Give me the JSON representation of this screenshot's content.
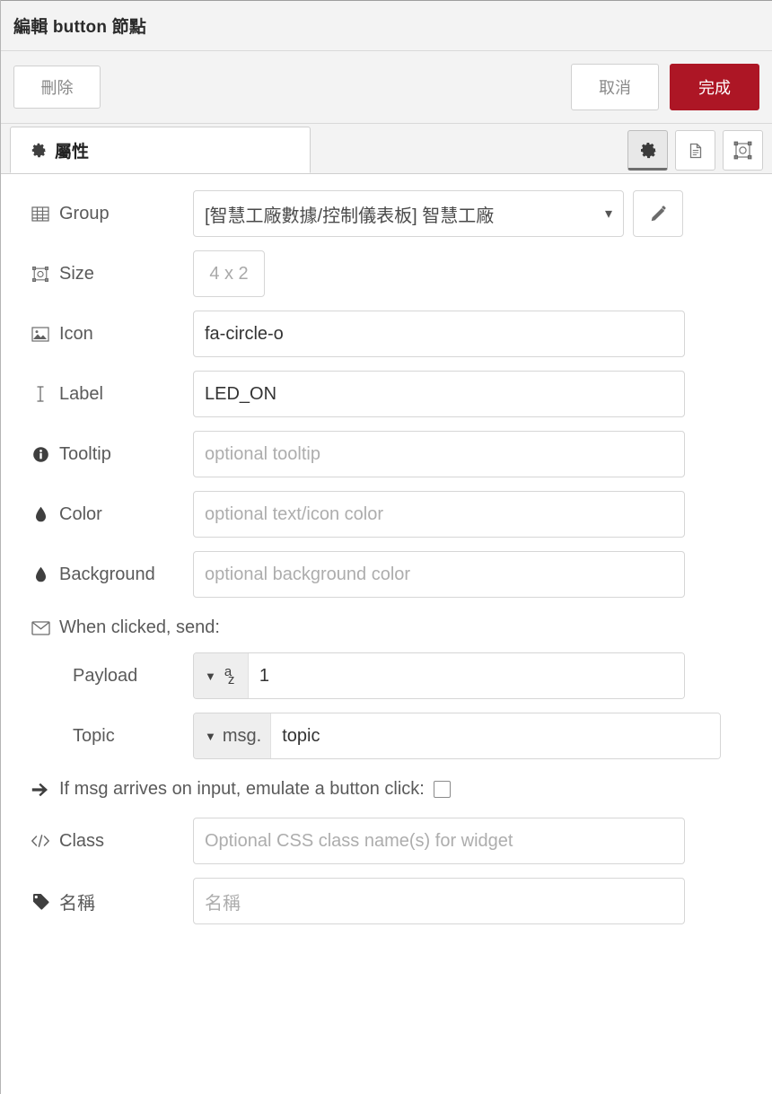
{
  "header": {
    "title_prefix": "編輯",
    "title_node": "button",
    "title_suffix": "節點",
    "title_full": "編輯 button 節點"
  },
  "toolbar": {
    "delete_label": "刪除",
    "cancel_label": "取消",
    "done_label": "完成",
    "done_color": "#ad1625"
  },
  "tabs": {
    "properties_label": "屬性",
    "properties_icon": "gear-icon",
    "tools": [
      {
        "name": "gear-icon",
        "active": true
      },
      {
        "name": "description-icon",
        "active": false
      },
      {
        "name": "appearance-icon",
        "active": false
      }
    ]
  },
  "form": {
    "group": {
      "label": "Group",
      "icon": "table-icon",
      "value": "[智慧工廠數據/控制儀表板] 智慧工廠",
      "caret": "chevron-down-icon",
      "edit_icon": "pencil-icon"
    },
    "size": {
      "label": "Size",
      "icon": "object-group-icon",
      "value": "4 x 2"
    },
    "icon_field": {
      "label": "Icon",
      "icon": "picture-icon",
      "value": "fa-circle-o"
    },
    "label_field": {
      "label": "Label",
      "icon": "text-cursor-icon",
      "value": "LED_ON"
    },
    "tooltip": {
      "label": "Tooltip",
      "icon": "info-circle-icon",
      "value": "",
      "placeholder": "optional tooltip"
    },
    "color": {
      "label": "Color",
      "icon": "tint-icon",
      "value": "",
      "placeholder": "optional text/icon color"
    },
    "background": {
      "label": "Background",
      "icon": "tint-icon",
      "value": "",
      "placeholder": "optional background color"
    },
    "when_clicked": {
      "label": "When clicked, send:",
      "icon": "envelope-icon"
    },
    "payload": {
      "label": "Payload",
      "type": "str",
      "type_icon": "az-string-icon",
      "value": "1"
    },
    "topic": {
      "label": "Topic",
      "type": "msg.",
      "value": "topic"
    },
    "emulate": {
      "label": "If msg arrives on input, emulate a button click:",
      "icon": "arrow-right-icon",
      "checked": false
    },
    "css_class": {
      "label": "Class",
      "icon": "code-icon",
      "value": "",
      "placeholder": "Optional CSS class name(s) for widget"
    },
    "name": {
      "label": "名稱",
      "icon": "tag-icon",
      "value": "",
      "placeholder": "名稱"
    }
  }
}
